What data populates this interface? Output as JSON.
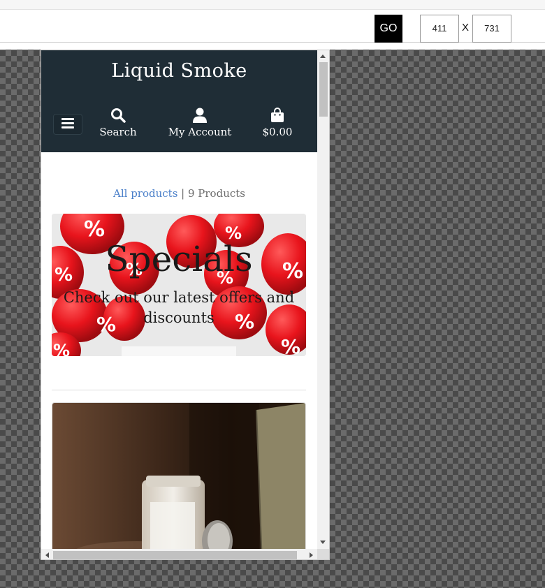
{
  "toolbar": {
    "go_label": "GO",
    "width_value": "411",
    "height_value": "731",
    "separator": "X"
  },
  "site": {
    "title": "Liquid Smoke",
    "nav": {
      "search_label": "Search",
      "account_label": "My Account",
      "cart_label": "$0.00"
    },
    "icons": [
      "menu-icon",
      "search-icon",
      "user-icon",
      "shopping-bag-icon"
    ]
  },
  "breadcrumb": {
    "link_label": "All products",
    "separator": " | ",
    "count_label": "9 Products"
  },
  "specials": {
    "title": "Specials",
    "subtitle": "Check out our latest offers and discounts"
  },
  "colors": {
    "header_bg": "#1f2d36",
    "link": "#4a7fc9",
    "balloon": "#e8141c"
  }
}
